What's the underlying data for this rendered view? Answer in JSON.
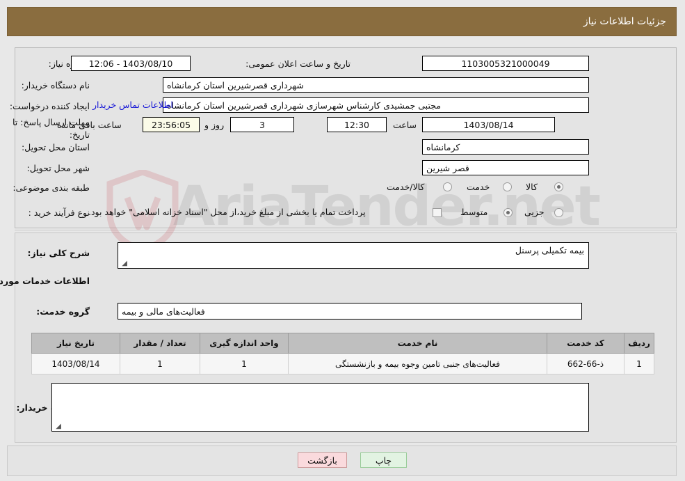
{
  "header": {
    "title": "جزئیات اطلاعات نیاز"
  },
  "fields": {
    "need_number_label": "شماره نیاز:",
    "need_number_value": "1103005321000049",
    "announce_label": "تاریخ و ساعت اعلان عمومی:",
    "announce_value": "1403/08/10 - 12:06",
    "buyer_org_label": "نام دستگاه خریدار:",
    "buyer_org_value": "شهرداری قصرشیرین استان کرمانشاه",
    "requester_label": "ایجاد کننده درخواست:",
    "requester_value": "مجتبی جمشیدی کارشناس شهرسازی شهرداری قصرشیرین استان کرمانشاه",
    "contact_link": "اطلاعات تماس خریدار",
    "deadline_label_line1": "مهلت ارسال پاسخ: تا",
    "deadline_label_line2": "تاریخ:",
    "deadline_date": "1403/08/14",
    "deadline_hour_label": "ساعت",
    "deadline_time": "12:30",
    "remaining_days": "3",
    "remaining_days_suffix": "روز و",
    "remaining_timer": "23:56:05",
    "remaining_timer_suffix": "ساعت باقی مانده",
    "province_label": "استان محل تحویل:",
    "province_value": "کرمانشاه",
    "city_label": "شهر محل تحویل:",
    "city_value": "قصر شیرین",
    "category_label": "طبقه بندی موضوعی:",
    "process_label": "نوع فرآیند خرید :",
    "treasury_note": "پرداخت تمام یا بخشی از مبلغ خرید،از محل \"اسناد خزانه اسلامی\" خواهد بود."
  },
  "category_options": [
    {
      "label": "کالا",
      "selected": false
    },
    {
      "label": "خدمت",
      "selected": true
    },
    {
      "label": "کالا/خدمت",
      "selected": false
    }
  ],
  "process_options": [
    {
      "label": "جزیی",
      "selected": false
    },
    {
      "label": "متوسط",
      "selected": true
    }
  ],
  "treasury_checkbox_checked": false,
  "description": {
    "need_summary_label": "شرح کلی نیاز:",
    "need_summary_value": "بیمه  تکمیلی  پرسنل",
    "section_title": "اطلاعات خدمات مورد نیاز",
    "service_group_label": "گروه خدمت:",
    "service_group_value": "فعالیت‌های مالی و بیمه",
    "buyer_notes_label": "توضیحات خریدار:",
    "buyer_notes_value": ""
  },
  "table": {
    "columns": [
      "ردیف",
      "کد خدمت",
      "نام خدمت",
      "واحد اندازه گیری",
      "تعداد / مقدار",
      "تاریخ نیاز"
    ],
    "rows": [
      {
        "row": "1",
        "code": "ذ-66-662",
        "name": "فعالیت‌های جنبی تامین وجوه بیمه و بازنشستگی",
        "unit": "1",
        "qty": "1",
        "date": "1403/08/14"
      }
    ]
  },
  "buttons": {
    "back": "بازگشت",
    "print": "چاپ"
  },
  "watermark": {
    "text": "AriaTender.net"
  },
  "colors": {
    "header_bg": "#8a6d3f",
    "link": "#1414d6",
    "back_btn": "#fadadd",
    "print_btn": "#e2f3e2",
    "timer_bg": "#fbfbe8"
  }
}
